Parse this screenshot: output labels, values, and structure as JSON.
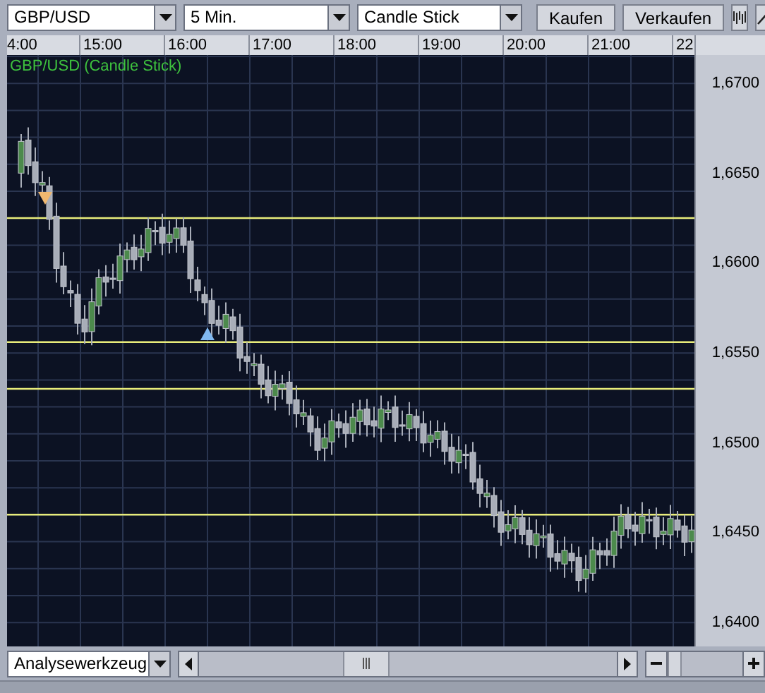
{
  "toolbar": {
    "selects": [
      {
        "value": "GBP/USD"
      },
      {
        "value": "5 Min."
      },
      {
        "value": "Candle Stick"
      }
    ],
    "buttons": [
      "Kaufen",
      "Verkaufen"
    ]
  },
  "time_axis": [
    "4:00",
    "15:00",
    "16:00",
    "17:00",
    "18:00",
    "19:00",
    "20:00",
    "21:00",
    "22"
  ],
  "chart": {
    "title": "GBP/USD (Candle Stick)",
    "price_labels": [
      "1,6700",
      "1,6650",
      "1,6600",
      "1,6550",
      "1,6500",
      "1,6450",
      "1,6400"
    ]
  },
  "bottom_bar": {
    "tool_select": {
      "value": "Analysewerkzeug"
    },
    "zoom_slider": {
      "level": 0
    }
  }
}
